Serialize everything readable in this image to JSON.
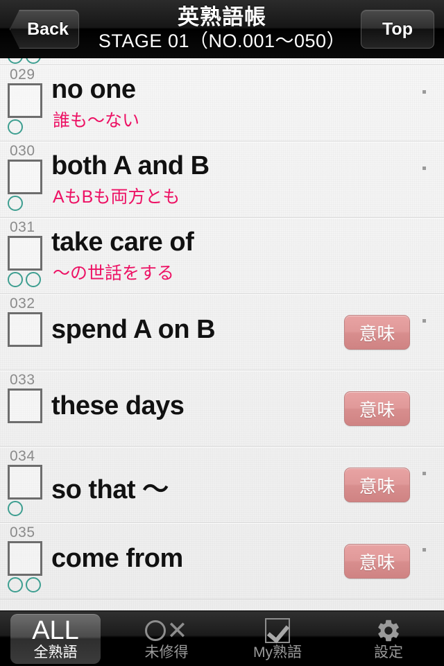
{
  "header": {
    "back_label": "Back",
    "app_title": "英熟語帳",
    "stage_title": "STAGE 01（NO.001〜050）",
    "top_label": "Top"
  },
  "list": {
    "meaning_button_label": "意味",
    "items": [
      {
        "number": "029",
        "english": "no one",
        "japanese": "誰も〜ない",
        "marks": 1,
        "show_meaning_button": false,
        "dot": true
      },
      {
        "number": "030",
        "english": "both A and B",
        "japanese": "AもBも両方とも",
        "marks": 1,
        "show_meaning_button": false,
        "dot": true
      },
      {
        "number": "031",
        "english": "take care of",
        "japanese": "〜の世話をする",
        "marks": 2,
        "show_meaning_button": false,
        "dot": false
      },
      {
        "number": "032",
        "english": "spend A on B",
        "japanese": "",
        "marks": 0,
        "show_meaning_button": true,
        "dot": true
      },
      {
        "number": "033",
        "english": "these days",
        "japanese": "",
        "marks": 0,
        "show_meaning_button": true,
        "dot": false
      },
      {
        "number": "034",
        "english": "so that 〜",
        "japanese": "",
        "marks": 1,
        "show_meaning_button": true,
        "dot": true
      },
      {
        "number": "035",
        "english": "come from",
        "japanese": "",
        "marks": 2,
        "show_meaning_button": true,
        "dot": true
      }
    ]
  },
  "tabbar": {
    "tabs": [
      {
        "glyph_text": "ALL",
        "icon": "all-text-icon",
        "label": "全熟語",
        "selected": true
      },
      {
        "glyph_text": "",
        "icon": "circle-x-icon",
        "label": "未修得",
        "selected": false
      },
      {
        "glyph_text": "",
        "icon": "checkbox-check-icon",
        "label": "My熟語",
        "selected": false
      },
      {
        "glyph_text": "",
        "icon": "gear-icon",
        "label": "設定",
        "selected": false
      }
    ]
  },
  "colors": {
    "accent_pink": "#ed1164",
    "meaning_button": "#dd9494",
    "mark_teal": "#3d9e90",
    "list_bg": "#f2f2f2"
  }
}
